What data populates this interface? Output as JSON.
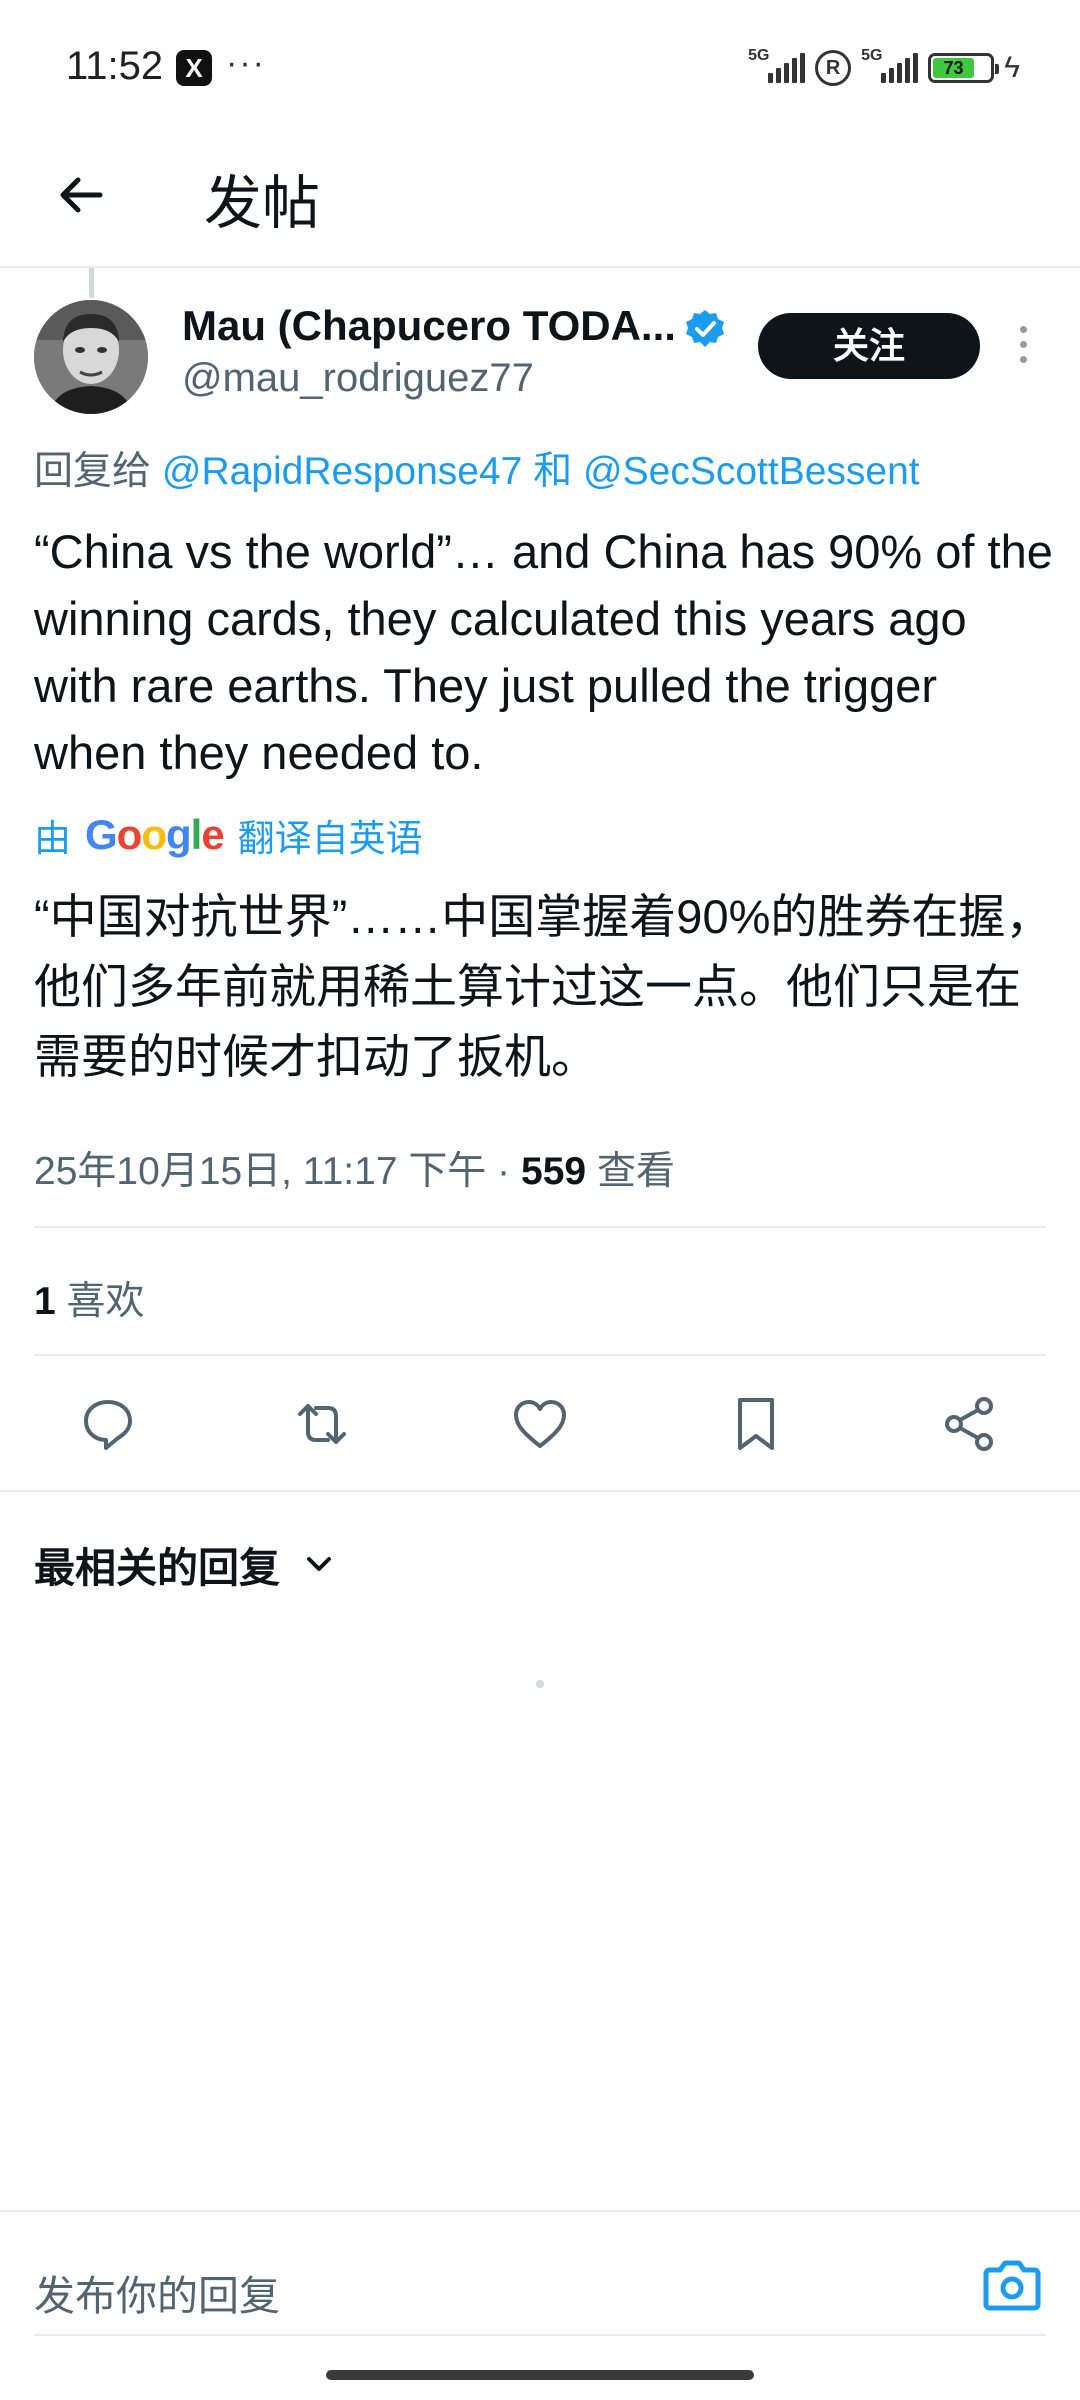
{
  "status_bar": {
    "time": "11:52",
    "app_icon": "X",
    "overflow": "···",
    "net1": "5G",
    "net2": "5G",
    "battery": "73"
  },
  "header": {
    "title": "发帖"
  },
  "author": {
    "name": "Mau (Chapucero TODA...",
    "handle": "@mau_rodriguez77",
    "follow_label": "关注"
  },
  "reply": {
    "prefix": "回复给",
    "mention1": "@RapidResponse47",
    "conj": "和",
    "mention2": "@SecScottBessent"
  },
  "tweet": {
    "text": "“China vs the world”… and China has 90% of the winning cards, they calculated this years ago with rare earths. They just pulled the trigger when they needed to.",
    "translate_by": "由",
    "translate_brand": "Google",
    "translate_label": "翻译自英语",
    "translated_text": "“中国对抗世界”……中国掌握着90%的胜券在握，他们多年前就用稀土算计过这一点。他们只是在需要的时候才扣动了扳机。",
    "timestamp": "25年10月15日, 11:17 下午 · ",
    "views_count": "559",
    "views_label": "查看"
  },
  "engagement": {
    "likes_count": "1",
    "likes_label": "喜欢"
  },
  "replies_sort": {
    "label": "最相关的回复"
  },
  "composer": {
    "placeholder": "发布你的回复"
  },
  "colors": {
    "accent": "#1d9bf0",
    "text": "#0f1419",
    "muted": "#536471",
    "divider": "#e7e9ea"
  }
}
